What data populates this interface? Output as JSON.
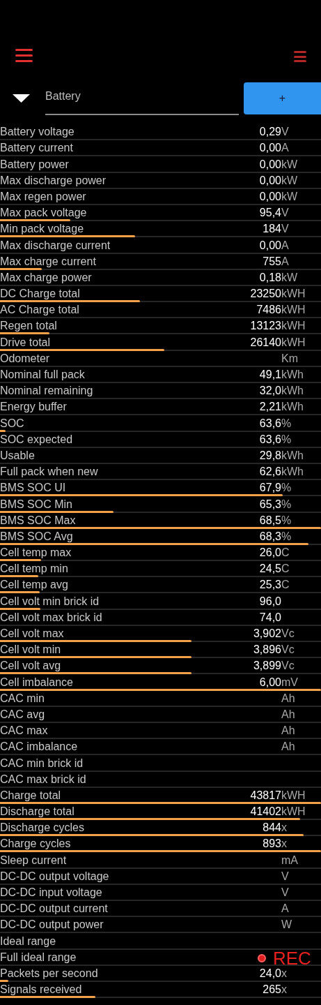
{
  "selector": {
    "value": "Battery",
    "add_button": "+"
  },
  "rows": [
    {
      "label": "Battery voltage",
      "value": "0,29",
      "unit": "V"
    },
    {
      "label": "Battery current",
      "value": "0,00",
      "unit": "A"
    },
    {
      "label": "Battery power",
      "value": "0,00",
      "unit": "kW"
    },
    {
      "label": "Max discharge power",
      "value": "0,00",
      "unit": "kW"
    },
    {
      "label": "Max regen power",
      "value": "0,00",
      "unit": "kW"
    },
    {
      "label": "Max pack voltage",
      "value": "95,4",
      "unit": "V",
      "level": 0.22
    },
    {
      "label": "Min pack voltage",
      "value": "184",
      "unit": "V",
      "level": 0.42
    },
    {
      "label": "Max discharge current",
      "value": "0,00",
      "unit": "A"
    },
    {
      "label": "Max charge current",
      "value": "755",
      "unit": "A",
      "level": 0.13
    },
    {
      "label": "Max charge power",
      "value": "0,18",
      "unit": "kW"
    },
    {
      "label": "DC Charge total",
      "value": "23250",
      "unit": "kWH",
      "level": 0.435
    },
    {
      "label": "AC Charge total",
      "value": "7486",
      "unit": "kWH"
    },
    {
      "label": "Regen total",
      "value": "13123",
      "unit": "kWH",
      "level": 0.155
    },
    {
      "label": "Drive total",
      "value": "26140",
      "unit": "kWH",
      "level": 0.513
    },
    {
      "label": "Odometer",
      "unit": "Km"
    },
    {
      "label": "Nominal full pack",
      "value": "49,1",
      "unit": "kWh"
    },
    {
      "label": "Nominal remaining",
      "value": "32,0",
      "unit": "kWh"
    },
    {
      "label": "Energy buffer",
      "value": "2,21",
      "unit": "kWh"
    },
    {
      "label": "SOC",
      "value": "63,6",
      "unit": "%",
      "level": 0.017
    },
    {
      "label": "SOC expected",
      "value": "63,6",
      "unit": "%"
    },
    {
      "label": "Usable",
      "value": "29,8",
      "unit": "kWh"
    },
    {
      "label": "Full pack when new",
      "value": "62,6",
      "unit": "kWh"
    },
    {
      "label": "BMS SOC UI",
      "value": "67,9",
      "unit": "%",
      "level": 0.88
    },
    {
      "label": "BMS SOC Min",
      "value": "65,3",
      "unit": "%",
      "level": 0.353
    },
    {
      "label": "BMS SOC Max",
      "value": "68,5",
      "unit": "%",
      "level": 1
    },
    {
      "label": "BMS SOC Avg",
      "value": "68,3",
      "unit": "%",
      "level": 0.96
    },
    {
      "label": "Cell temp max",
      "value": "26,0",
      "unit": "C",
      "level": 0.127
    },
    {
      "label": "Cell temp min",
      "value": "24,5",
      "unit": "C",
      "level": 0.12
    },
    {
      "label": "Cell temp avg",
      "value": "25,3",
      "unit": "C",
      "level": 0.124
    },
    {
      "label": "Cell volt min brick id",
      "value": "96,0",
      "level": 0.126
    },
    {
      "label": "Cell volt max brick id",
      "value": "74,0"
    },
    {
      "label": "Cell volt max",
      "value": "3,902",
      "unit": "Vc",
      "level": 0.597
    },
    {
      "label": "Cell volt min",
      "value": "3,896",
      "unit": "Vc",
      "level": 0.596
    },
    {
      "label": "Cell volt avg",
      "value": "3,899",
      "unit": "Vc",
      "level": 0.596
    },
    {
      "label": "Cell imbalance",
      "value": "6,00",
      "unit": "mV",
      "level": 1
    },
    {
      "label": "CAC min",
      "unit": "Ah"
    },
    {
      "label": "CAC avg",
      "unit": "Ah"
    },
    {
      "label": "CAC max",
      "unit": "Ah"
    },
    {
      "label": "CAC imbalance",
      "unit": "Ah"
    },
    {
      "label": "CAC min brick id"
    },
    {
      "label": "CAC max brick id"
    },
    {
      "label": "Charge total",
      "value": "43817",
      "unit": "kWH",
      "level": 1
    },
    {
      "label": "Discharge total",
      "value": "41402",
      "unit": "kWH",
      "level": 0.935
    },
    {
      "label": "Discharge cycles",
      "value": "844",
      "unit": "x",
      "level": 0.946
    },
    {
      "label": "Charge cycles",
      "value": "893",
      "unit": "x",
      "level": 1
    },
    {
      "label": "Sleep current",
      "unit": "mA"
    },
    {
      "label": "DC-DC output voltage",
      "unit": "V"
    },
    {
      "label": "DC-DC input voltage",
      "unit": "V"
    },
    {
      "label": "DC-DC output current",
      "unit": "A"
    },
    {
      "label": "DC-DC output power",
      "unit": "W"
    },
    {
      "label": "Ideal range"
    },
    {
      "label": "Full ideal range"
    },
    {
      "label": "Packets per second",
      "value": "24,0",
      "unit": "x",
      "level": 0.026
    },
    {
      "label": "Signals received",
      "value": "265",
      "unit": "x",
      "level": 0.297
    }
  ],
  "recording_indicator": {
    "label": "REC"
  }
}
